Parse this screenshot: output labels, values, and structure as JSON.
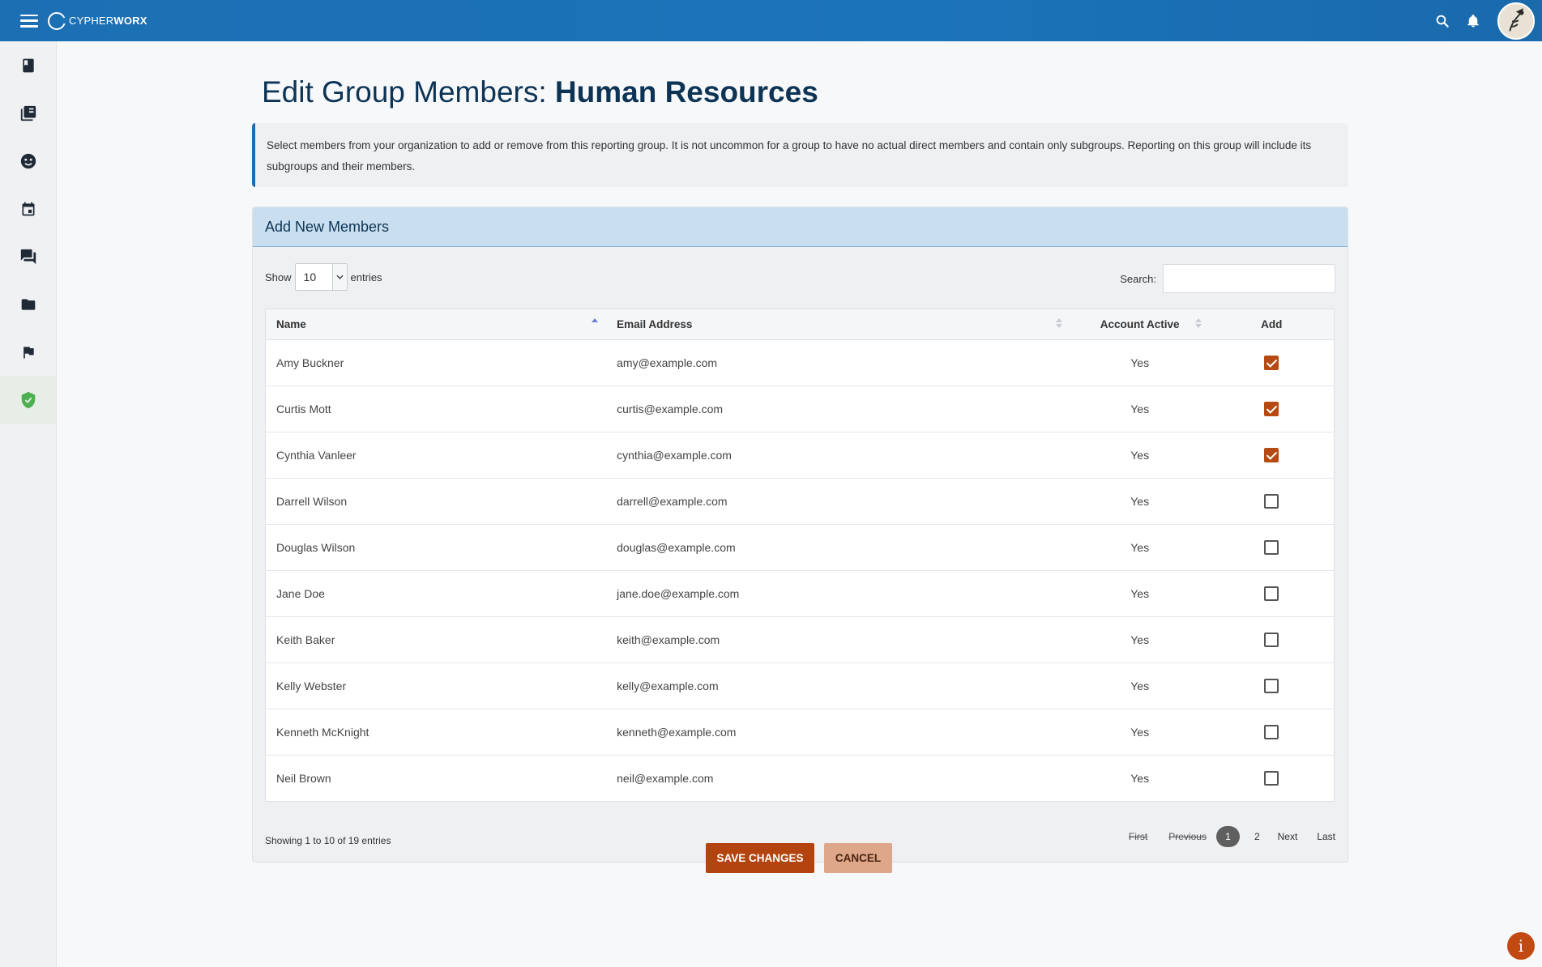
{
  "app": {
    "logo_thin": "CYPHER",
    "logo_bold": "WORX"
  },
  "topbar": {
    "icons": [
      "hamburger-menu-icon",
      "search-icon",
      "bell-icon",
      "avatar"
    ]
  },
  "sidebar": {
    "items": [
      {
        "icon": "book-icon",
        "active": false
      },
      {
        "icon": "library-icon",
        "active": false
      },
      {
        "icon": "face-icon",
        "active": false
      },
      {
        "icon": "calendar-icon",
        "active": false
      },
      {
        "icon": "forum-icon",
        "active": false
      },
      {
        "icon": "folder-icon",
        "active": false
      },
      {
        "icon": "flag-icon",
        "active": false
      },
      {
        "icon": "shield-check-icon",
        "active": true
      }
    ]
  },
  "page": {
    "title_prefix": "Edit Group Members: ",
    "title_group": "Human Resources",
    "info": "Select members from your organization to add or remove from this reporting group. It is not uncommon for a group to have no actual direct members and contain only subgroups. Reporting on this group will include its subgroups and their members."
  },
  "card": {
    "header": "Add New Members",
    "show_label": "Show",
    "entries_value": "10",
    "entries_label": "entries",
    "search_label": "Search:",
    "search_value": "",
    "columns": {
      "name": "Name",
      "email": "Email Address",
      "active": "Account Active",
      "add": "Add"
    },
    "rows": [
      {
        "name": "Amy Buckner",
        "email": "amy@example.com",
        "active": "Yes",
        "checked": true
      },
      {
        "name": "Curtis Mott",
        "email": "curtis@example.com",
        "active": "Yes",
        "checked": true
      },
      {
        "name": "Cynthia Vanleer",
        "email": "cynthia@example.com",
        "active": "Yes",
        "checked": true
      },
      {
        "name": "Darrell Wilson",
        "email": "darrell@example.com",
        "active": "Yes",
        "checked": false
      },
      {
        "name": "Douglas Wilson",
        "email": "douglas@example.com",
        "active": "Yes",
        "checked": false
      },
      {
        "name": "Jane Doe",
        "email": "jane.doe@example.com",
        "active": "Yes",
        "checked": false
      },
      {
        "name": "Keith Baker",
        "email": "keith@example.com",
        "active": "Yes",
        "checked": false
      },
      {
        "name": "Kelly Webster",
        "email": "kelly@example.com",
        "active": "Yes",
        "checked": false
      },
      {
        "name": "Kenneth McKnight",
        "email": "kenneth@example.com",
        "active": "Yes",
        "checked": false
      },
      {
        "name": "Neil Brown",
        "email": "neil@example.com",
        "active": "Yes",
        "checked": false
      }
    ],
    "showing": "Showing 1 to 10 of 19 entries",
    "pager": {
      "first": "First",
      "previous": "Previous",
      "current": "1",
      "page2": "2",
      "next": "Next",
      "last": "Last"
    }
  },
  "actions": {
    "save": "SAVE CHANGES",
    "cancel": "CANCEL"
  },
  "help": {
    "label": "i"
  },
  "colors": {
    "topbar": "#1b73b9",
    "accent": "#b3440f",
    "title": "#0d3455",
    "active_side": "#4caf50"
  }
}
